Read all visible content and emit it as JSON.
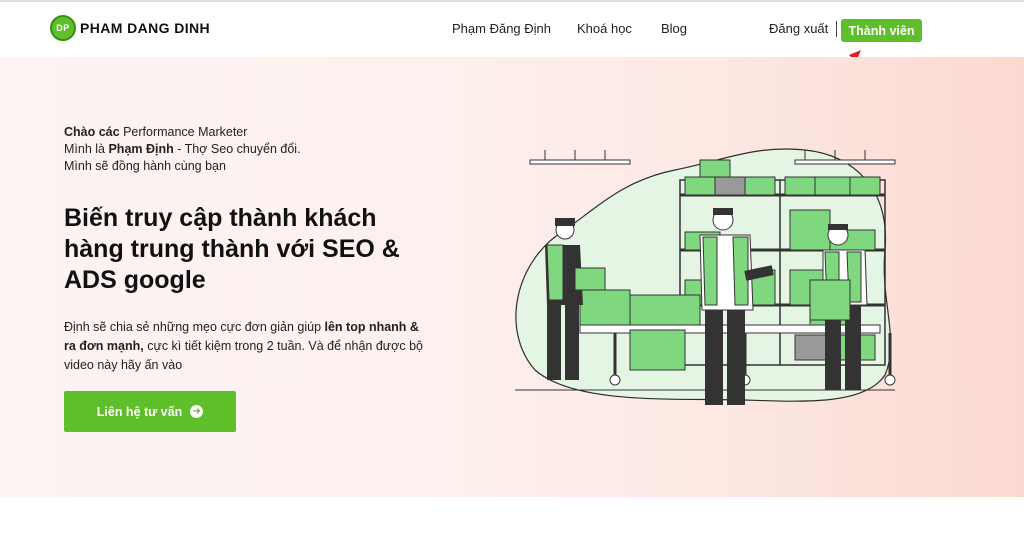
{
  "header": {
    "logo_badge": "DP",
    "logo_text": "PHAM DANG DINH",
    "nav": [
      "Phạm Đăng Định",
      "Khoá học",
      "Blog"
    ],
    "logout": "Đăng xuất",
    "member_button": "Thành viên"
  },
  "hero": {
    "greeting_line1_bold": "Chào các",
    "greeting_line1_rest": " Performance Marketer",
    "greeting_line2_pre": "Mình là ",
    "greeting_line2_bold": "Phạm Định",
    "greeting_line2_rest": " -  Thợ Seo chuyển đổi.",
    "greeting_line3": "Mình sẽ đồng hành cùng bạn",
    "headline": "Biến truy cập thành khách hàng trung thành với SEO & ADS google",
    "desc_pre": "Định sẽ chia sẻ những mẹo cực đơn giản giúp ",
    "desc_bold1": "lên top nhanh & ra đơn mạnh,",
    "desc_rest": " cực kì tiết kiệm trong 2 tuần. Và để nhận được bộ video này hãy ấn vào",
    "cta_label": "Liên hệ tư vấn",
    "cta_icon": "arrow-right-circle-icon"
  },
  "colors": {
    "accent": "#5fbf2a",
    "hero_bg_left": "#fcf3f3",
    "hero_bg_right": "#fbd9d1",
    "annotation_arrow": "#e02020"
  }
}
